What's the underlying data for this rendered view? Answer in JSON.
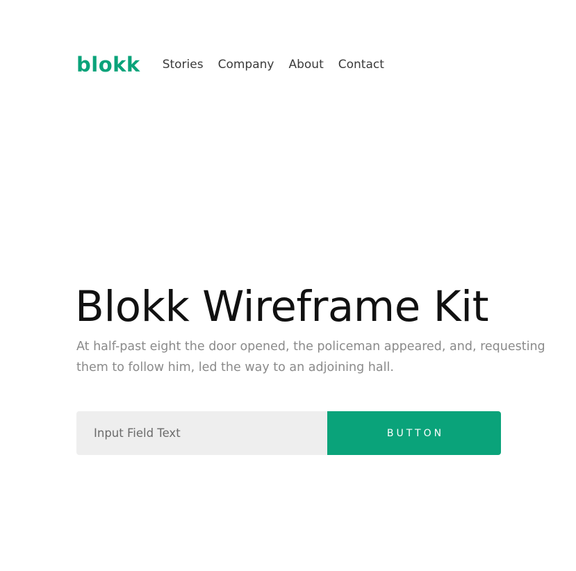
{
  "header": {
    "logo_text": "blokk",
    "nav": [
      {
        "label": "Stories"
      },
      {
        "label": "Company"
      },
      {
        "label": "About"
      },
      {
        "label": "Contact"
      }
    ]
  },
  "hero": {
    "title": "Blokk Wireframe Kit",
    "subtitle": "At half-past eight the door opened, the policeman appeared, and, requesting them to follow him, led the way to an adjoining hall."
  },
  "form": {
    "input_placeholder": "Input Field Text",
    "button_label": "BUTTON"
  },
  "colors": {
    "accent": "#0aa37a",
    "input_bg": "#eeeeee",
    "title": "#111111",
    "subtitle": "#8a8a8a",
    "nav_text": "#3a3a3a"
  }
}
